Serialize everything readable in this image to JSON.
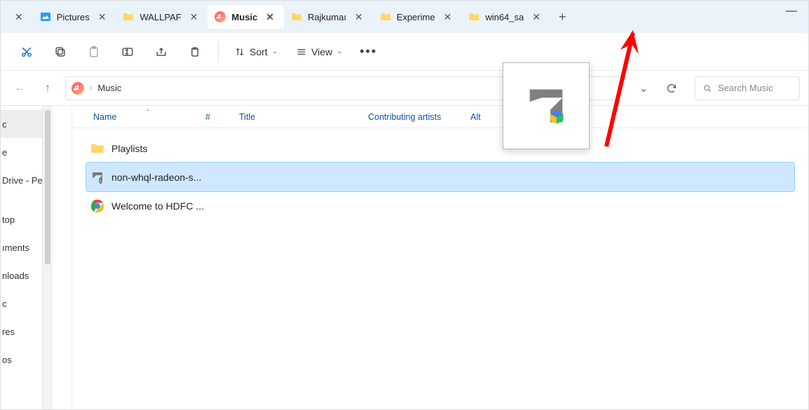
{
  "tabs": [
    {
      "label": "",
      "icon": "close-only"
    },
    {
      "label": "Pictures",
      "icon": "pictures"
    },
    {
      "label": "WALLPAF",
      "icon": "folder"
    },
    {
      "label": "Music",
      "icon": "music",
      "active": true
    },
    {
      "label": "Rajkumaı",
      "icon": "folder"
    },
    {
      "label": "Experime",
      "icon": "folder"
    },
    {
      "label": "win64_sa",
      "icon": "folder"
    }
  ],
  "minimize": "—",
  "toolbar": {
    "sort": "Sort",
    "view": "View"
  },
  "breadcrumb": {
    "location": "Music"
  },
  "path_controls": {
    "chev": "⌄",
    "refresh": "↻"
  },
  "search": {
    "placeholder": "Search Music"
  },
  "nav": {
    "items": [
      "c",
      "e",
      "Drive - Per",
      "top",
      "ıments",
      "nloads",
      "c",
      "res",
      "os"
    ]
  },
  "columns": {
    "name": "Name",
    "num": "#",
    "title": "Title",
    "artists": "Contributing artists",
    "alb": "Alt"
  },
  "rows": [
    {
      "name": "Playlists",
      "icon": "folder",
      "selected": false
    },
    {
      "name": "non-whql-radeon-s...",
      "icon": "amd",
      "selected": true
    },
    {
      "name": "Welcome to HDFC ...",
      "icon": "chrome",
      "selected": false
    }
  ]
}
